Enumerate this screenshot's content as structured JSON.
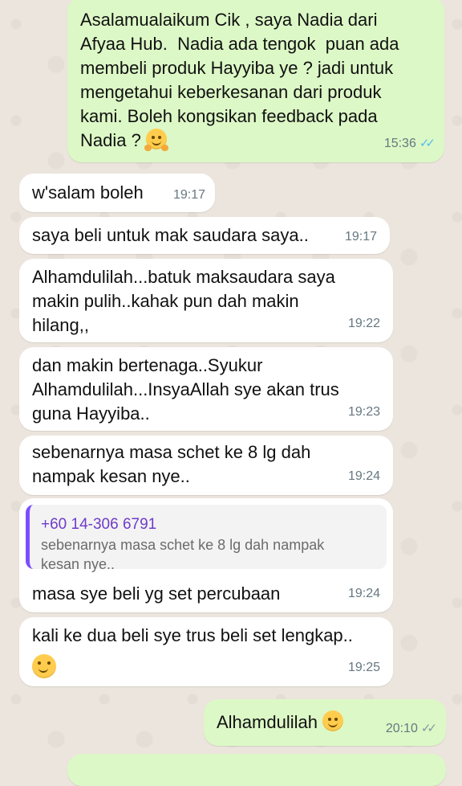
{
  "messages": [
    {
      "type": "out",
      "text": "Asalamualaikum Cik , saya Nadia dari\nAfyaa Hub.  Nadia ada tengok  puan ada\nmembeli produk Hayyiba ye ? jadi untuk\nmengetahui keberkesanan dari produk\nkami. Boleh kongsikan feedback pada\nNadia ? ",
      "emoji": "hugging-face",
      "time": "15:36",
      "status": "read"
    },
    {
      "type": "in",
      "text": "w'salam boleh",
      "time": "19:17"
    },
    {
      "type": "in",
      "text": "saya beli untuk mak saudara saya..",
      "time": "19:17"
    },
    {
      "type": "in",
      "text": "Alhamdulilah...batuk maksaudara saya\nmakin pulih..kahak pun dah makin\nhilang,,",
      "time": "19:22"
    },
    {
      "type": "in",
      "text": "dan makin bertenaga..Syukur\nAlhamdulilah...InsyaAllah sye akan trus\nguna Hayyiba..",
      "time": "19:23"
    },
    {
      "type": "in",
      "text": "sebenarnya masa schet ke 8 lg dah\nnampak kesan nye..",
      "time": "19:24"
    },
    {
      "type": "in",
      "quote": {
        "sender": "+60 14-306 6791",
        "text": "sebenarnya masa schet ke 8 lg dah nampak\nkesan nye.."
      },
      "text": "masa sye beli yg set percubaan",
      "time": "19:24"
    },
    {
      "type": "in",
      "text": "kali ke dua beli sye trus beli set lengkap..",
      "emoji": "smiling-face",
      "time": "19:25"
    },
    {
      "type": "out",
      "text": "Alhamdulilah ",
      "emoji": "smiling-face",
      "time": "20:10",
      "status": "delivered"
    }
  ],
  "icons": {
    "read_ticks": "double-check-blue",
    "delivered_ticks": "double-check-grey"
  },
  "colors": {
    "outgoing": "#dcf8c6",
    "incoming": "#ffffff",
    "read": "#53bdeb",
    "quote_bar": "#7c4dff"
  }
}
